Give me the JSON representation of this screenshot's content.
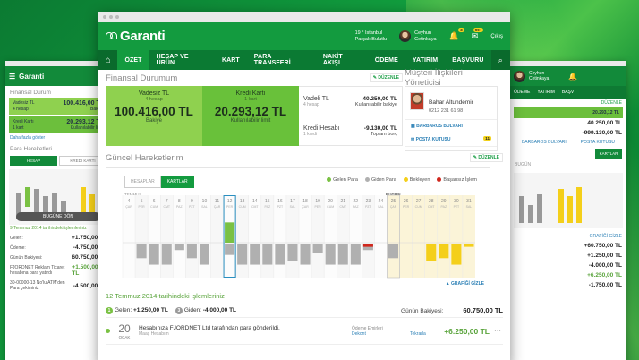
{
  "brand": {
    "name": "Garanti"
  },
  "header": {
    "weather_temp": "19 ° İstanbul",
    "weather_desc": "Parçalı Bulutlu",
    "user_first": "Ceyhun",
    "user_last": "Cetinkaya",
    "notif_badge": "3",
    "msg_badge": "99+",
    "logout": "Çıkış"
  },
  "nav": [
    "ÖZET",
    "HESAP VE ÜRÜN",
    "KART",
    "PARA TRANSFERİ",
    "NAKİT AKIŞI",
    "ÖDEME",
    "YATIRIM",
    "BAŞVURU"
  ],
  "finance": {
    "title": "Finansal Durumum",
    "edit": "DÜZENLE",
    "card1": {
      "title": "Vadesiz TL",
      "sub": "4 hesap",
      "value": "100.416,00 TL",
      "unit": "Bakiye"
    },
    "card2": {
      "title": "Kredi Kartı",
      "sub": "1 kart",
      "value": "20.293,12 TL",
      "unit": "Kullanılabilir limit"
    },
    "rows": [
      {
        "label": "Vadeli TL",
        "sub": "4 hesap",
        "value": "40.250,00 TL",
        "unit": "Kullanılabilir bakiye"
      },
      {
        "label": "Kredi Hesabı",
        "sub": "1 kredi",
        "value": "-9.130,00 TL",
        "unit": "Toplam borç"
      }
    ]
  },
  "manager": {
    "title": "Müşteri İlişkileri Yöneticisi",
    "name": "Bahar Altundemir",
    "phone": "0212 231 61 98",
    "branch": "BARBAROS BULVARI",
    "mailbox": "POSTA KUTUSU",
    "mailbox_count": "11"
  },
  "activity": {
    "title": "Güncel Hareketlerim",
    "edit": "DÜZENLE",
    "tabs": [
      "HESAPLAR",
      "KARTLAR"
    ],
    "legend": [
      {
        "label": "Gelen Para",
        "color": "#7ac143"
      },
      {
        "label": "Giden Para",
        "color": "#b0b0b0"
      },
      {
        "label": "Bekleyen",
        "color": "#f4cf1a"
      },
      {
        "label": "Başarısız İşlem",
        "color": "#d0271d"
      }
    ],
    "month": "TEMMUZ",
    "today": "BUGÜN",
    "hide": "GRAFİĞİ GİZLE"
  },
  "chart_data": {
    "type": "bar",
    "x": [
      "4",
      "5",
      "6",
      "7",
      "8",
      "9",
      "10",
      "11",
      "12",
      "13",
      "14",
      "15",
      "16",
      "17",
      "18",
      "19",
      "20",
      "21",
      "22",
      "23",
      "24",
      "25",
      "26",
      "27",
      "28",
      "29",
      "30",
      "31"
    ],
    "days": [
      "ÇAR",
      "PER",
      "CUM",
      "CMT",
      "PAZ",
      "PZT",
      "SAL",
      "ÇAR",
      "PER",
      "CUM",
      "CMT",
      "PAZ",
      "PZT",
      "SAL",
      "ÇAR",
      "PER",
      "CUM",
      "CMT",
      "PAZ",
      "PZT",
      "SAL",
      "ÇAR",
      "PER",
      "CUM",
      "CMT",
      "PAZ",
      "PZT",
      "SAL"
    ],
    "series": [
      {
        "name": "Gelen Para",
        "values": [
          0,
          0,
          0,
          0,
          0,
          0,
          0,
          0,
          1250,
          0,
          0,
          0,
          0,
          0,
          0,
          0,
          0,
          0,
          0,
          0,
          0,
          0,
          0,
          0,
          0,
          0,
          0,
          0
        ]
      },
      {
        "name": "Giden Para",
        "values": [
          0,
          -900,
          -1300,
          -1300,
          -400,
          -900,
          -1300,
          0,
          -700,
          -1300,
          -1300,
          -1300,
          -1300,
          -1100,
          -1300,
          -600,
          -1300,
          -1300,
          -1300,
          -400,
          0,
          -900,
          0,
          0,
          0,
          0,
          0,
          0
        ]
      },
      {
        "name": "Bekleyen",
        "values": [
          0,
          0,
          0,
          0,
          0,
          0,
          0,
          0,
          0,
          0,
          0,
          0,
          0,
          0,
          0,
          0,
          0,
          0,
          0,
          0,
          0,
          0,
          0,
          0,
          -1100,
          -900,
          -1300,
          -200
        ]
      },
      {
        "name": "Başarısız İşlem",
        "values": [
          0,
          0,
          0,
          0,
          0,
          0,
          0,
          0,
          0,
          0,
          0,
          0,
          0,
          0,
          0,
          0,
          0,
          0,
          0,
          -200,
          0,
          0,
          0,
          0,
          0,
          0,
          0,
          0
        ]
      }
    ],
    "ylim": [
      -1600,
      1600
    ]
  },
  "transactions": {
    "date_title": "12 Temmuz 2014 tarihindeki işlemleriniz",
    "incoming_label": "Gelen:",
    "incoming": "+1.250,00 TL",
    "outgoing_label": "Giden:",
    "outgoing": "-4.000,00 TL",
    "balance_label": "Günün Bakiyesi:",
    "balance": "60.750,00 TL",
    "items": [
      {
        "day": "20",
        "month": "OCAK",
        "desc": "Hesabınıza FJORDNET Ltd tarafından para gönderildi.",
        "sub": "Maaş Hesabım",
        "tag": "Ödeme Emirleri",
        "link1": "Dekont",
        "link2": "Tekrarla",
        "amount": "+6.250,00 TL"
      }
    ]
  },
  "left_panel": {
    "title": "Finansal Durum",
    "r1_label": "Vadesiz TL",
    "r1_sub": "4 hesap",
    "r1_val": "100.416,00 TL",
    "r1_unit": "Bakiye",
    "r2_label": "Kredi Kartı",
    "r2_sub": "1 kart",
    "r2_val": "20.293,12 TL",
    "r2_unit": "Kullanılabilir limit",
    "more": "Daha fazla göster",
    "moves": "Para Hareketleri",
    "tab1": "HESAP",
    "tab2": "KREDİ KARTI",
    "today_btn": "BUGÜNE DÖN",
    "date": "9 Temmuz 2014 tarihindeki işlemleriniz",
    "in_label": "Gelen:",
    "in_val": "+1.750,00 TL",
    "out_label": "Ödeme:",
    "out_val": "-4.750,00 TL",
    "bal_label": "Günün Bakiyesi:",
    "bal_val": "60.750,00 TL",
    "item1": "FJORDNET Reklam Ticaret hesabına para yatırdı",
    "item1_amt": "+1.500,00 TL",
    "item2": "30-00000-13 No'lu ATM'den Para çekiminiz",
    "item2_amt": "-4.500,00 TL"
  },
  "right_panel": {
    "user": "Ceyhun Cetinkaya",
    "nav1": "ÖDEME",
    "nav2": "YATIRIM",
    "nav3": "BAŞV",
    "edit": "DÜZENLE",
    "r1_sub": "20.293,12 TL",
    "r2_val": "40.250,00 TL",
    "r3_val": "-999.130,00 TL",
    "link1": "BARBAROS BULVARI",
    "link2": "POSTA KUTUSU",
    "tab": "KARTLAR",
    "today": "BUGÜN",
    "hide": "GRAFİĞİ GİZLE",
    "rv1": "+60.750,00 TL",
    "rv2": "+1.250,00 TL",
    "rv3": "-4.000,00 TL",
    "rv4": "+6.250,00 TL",
    "rv5": "-1.750,00 TL"
  }
}
